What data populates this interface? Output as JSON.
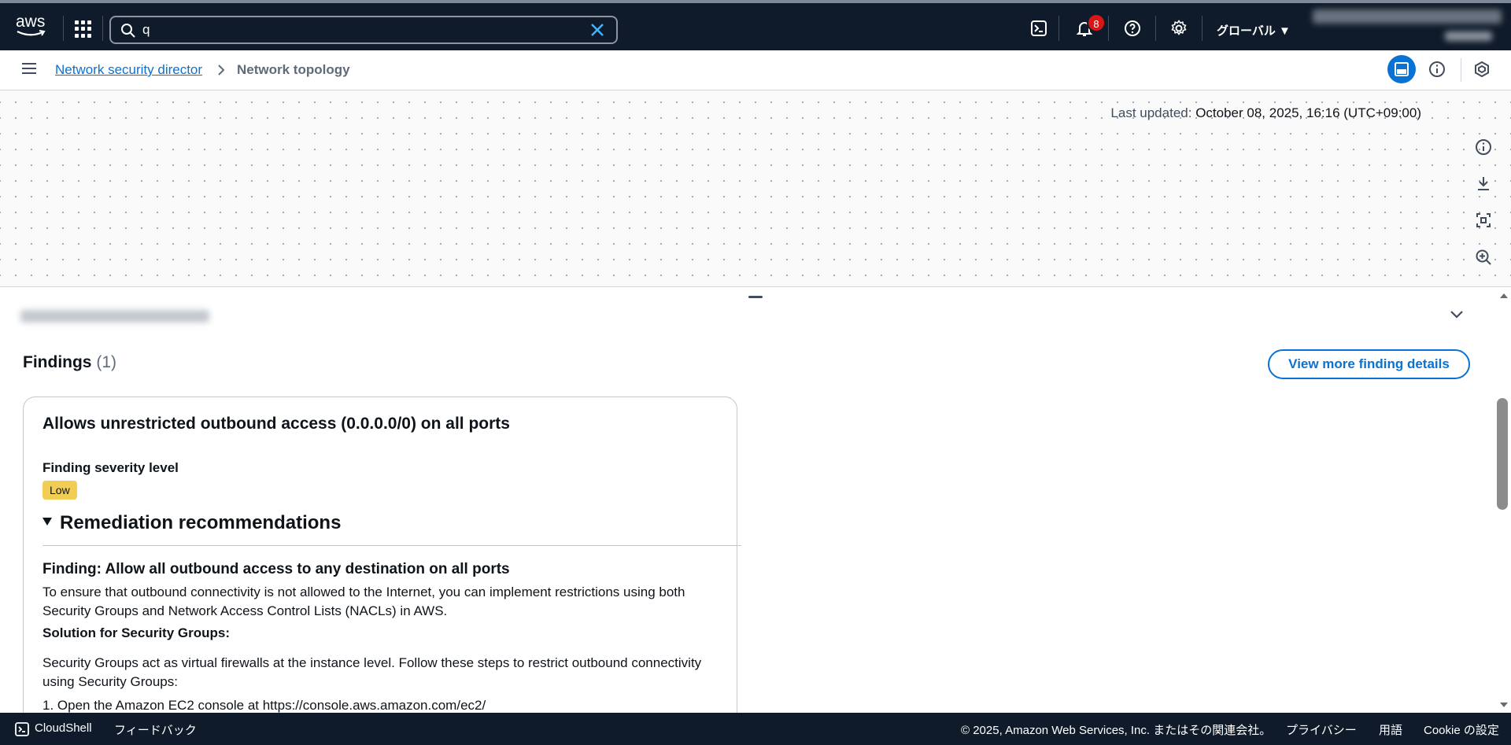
{
  "topnav": {
    "logo_text": "aws",
    "search_value": "q",
    "notification_count": "8",
    "region_label": "グローバル ▼"
  },
  "breadcrumb": {
    "parent": "Network security director",
    "current": "Network topology"
  },
  "canvas": {
    "last_updated_label": "Last updated:",
    "last_updated_value": "October 08, 2025, 16:16 (UTC+09:00)"
  },
  "panel": {
    "findings_label": "Findings",
    "findings_count": "(1)",
    "view_more_label": "View more finding details",
    "card": {
      "title": "Allows unrestricted outbound access (0.0.0.0/0) on all ports",
      "severity_label": "Finding severity level",
      "severity_value": "Low",
      "remediation_heading": "Remediation recommendations",
      "finding_heading": "Finding: Allow all outbound access to any destination on all ports",
      "para1": "To ensure that outbound connectivity is not allowed to the Internet, you can implement restrictions using both Security Groups and Network Access Control Lists (NACLs) in AWS.",
      "solution_heading": "Solution for Security Groups:",
      "para2": "Security Groups act as virtual firewalls at the instance level. Follow these steps to restrict outbound connectivity using Security Groups:",
      "step1": "1. Open the Amazon EC2 console at https://console.aws.amazon.com/ec2/"
    }
  },
  "footer": {
    "cloudshell": "CloudShell",
    "feedback": "フィードバック",
    "copyright": "© 2025, Amazon Web Services, Inc. またはその関連会社。",
    "privacy": "プライバシー",
    "terms": "用語",
    "cookie": "Cookie の設定"
  },
  "colors": {
    "nav_bg": "#0f1b2a",
    "link": "#0972d3",
    "severity_low": "#f2cd54",
    "badge_red": "#d91515"
  }
}
